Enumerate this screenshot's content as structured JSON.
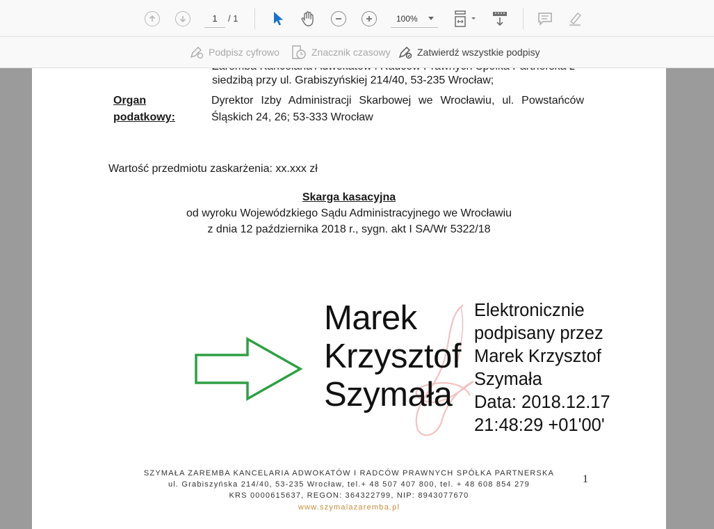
{
  "toolbar": {
    "page_current": "1",
    "page_total": "/ 1",
    "zoom": "100%",
    "icons": [
      "prev-page-icon",
      "next-page-icon",
      "select-cursor-icon",
      "hand-tool-icon",
      "zoom-out-icon",
      "zoom-in-icon",
      "fit-page-icon",
      "scroll-mode-icon",
      "comment-icon",
      "highlight-icon"
    ]
  },
  "signature_bar": {
    "sign_digitally": "Podpisz cyfrowo",
    "timestamp": "Znacznik czasowy",
    "validate_all": "Zatwierdź wszystkie podpisy"
  },
  "document": {
    "line_cut_top": "Zaremba Kancelaria Adwokatów i Radców Prawnych Spółka Partnerska z",
    "line_cut_2": "siedzibą przy ul. Grabiszyńskiej 214/40, 53-235 Wrocław;",
    "organ_label": "Organ podatkowy:",
    "organ_text": "Dyrektor Izby Administracji Skarbowej we Wrocławiu, ul. Powstańców Śląskich 24, 26; 53-333 Wrocław",
    "value_line": "Wartość przedmiotu zaskarżenia: xx.xxx zł",
    "heading": "Skarga kasacyjna",
    "heading_line1": "od wyroku Wojewódzkiego Sądu Administracyjnego we Wrocławiu",
    "heading_line2": "z dnia 12 października 2018 r., sygn. akt I SA/Wr 5322/18",
    "signature": {
      "name_line1": "Marek",
      "name_line2": "Krzysztof",
      "name_line3": "Szymała",
      "detail1": "Elektronicznie",
      "detail2": "podpisany przez",
      "detail3": "Marek Krzysztof",
      "detail4": "Szymała",
      "detail5": "Data: 2018.12.17",
      "detail6": "21:48:29 +01'00'"
    },
    "footer": {
      "line1": "SZYMAŁA ZAREMBA KANCELARIA ADWOKATÓW I RADCÓW PRAWNYCH SPÓŁKA PARTNERSKA",
      "line2": "ul. Grabiszyńska 214/40, 53-235 Wrocław, tel.+ 48 507 407 800, tel. + 48 608 854 279",
      "line3": "KRS 0000615637, REGON: 364322799, NIP: 8943077670",
      "line4": "www.szymalazaremba.pl"
    },
    "page_number": "1"
  },
  "colors": {
    "arrow": "#2ea043",
    "select_tool": "#1a73c8",
    "footer_link": "#c98d3b"
  }
}
